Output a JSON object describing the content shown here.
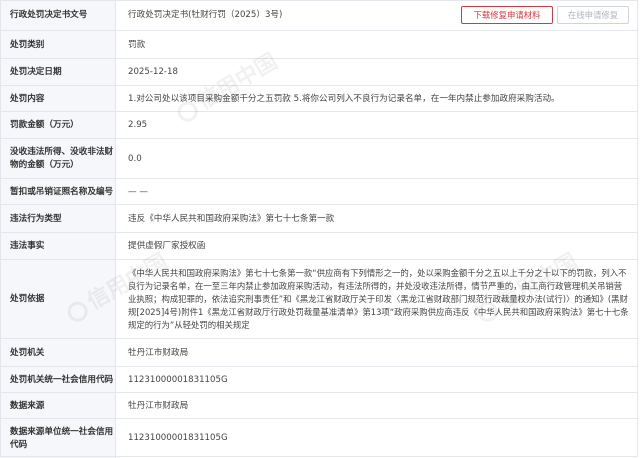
{
  "header": {
    "label": "行政处罚决定书文号",
    "value": "行政处罚决定书(牡财行罚（2025）3号)",
    "download_button": "下载修复申请材料",
    "online_button": "在线申请修复"
  },
  "rows": [
    {
      "label": "处罚类别",
      "value": "罚款"
    },
    {
      "label": "处罚决定日期",
      "value": "2025-12-18"
    },
    {
      "label": "处罚内容",
      "value": "1.对公司处以该项目采购金额千分之五罚款 5.将你公司列入不良行为记录名单，在一年内禁止参加政府采购活动。"
    },
    {
      "label": "罚款金额（万元）",
      "value": "2.95"
    },
    {
      "label": "没收违法所得、没收非法财物的金额（万元）",
      "value": "0.0"
    },
    {
      "label": "暂扣或吊销证照名称及编号",
      "value": "— —"
    },
    {
      "label": "违法行为类型",
      "value": "违反《中华人民共和国政府采购法》第七十七条第一款"
    },
    {
      "label": "违法事实",
      "value": "提供虚假厂家授权函"
    },
    {
      "label": "处罚依据",
      "value": "《中华人民共和国政府采购法》第七十七条第一款“供应商有下列情形之一的，处以采购金额千分之五以上千分之十以下的罚款，列入不良行为记录名单，在一至三年内禁止参加政府采购活动，有违法所得的，并处没收违法所得，情节严重的，由工商行政管理机关吊销营业执照；构成犯罪的，依法追究刑事责任”和《黑龙江省财政厅关于印发〈黑龙江省财政部门规范行政裁量权办法(试行)〉的通知》(黑财规[2025]4号)附件1《黑龙江省财政厅行政处罚裁量基准清单》第13项“政府采购供应商违反《中华人民共和国政府采购法》第七十七条规定的行为”从轻处罚的相关规定"
    },
    {
      "label": "处罚机关",
      "value": "牡丹江市财政局"
    },
    {
      "label": "处罚机关统一社会信用代码",
      "value": "11231000001831105G"
    },
    {
      "label": "数据来源",
      "value": "牡丹江市财政局"
    },
    {
      "label": "数据来源单位统一社会信用代码",
      "value": "11231000001831105G"
    }
  ],
  "watermark": {
    "text": "信用中国"
  }
}
